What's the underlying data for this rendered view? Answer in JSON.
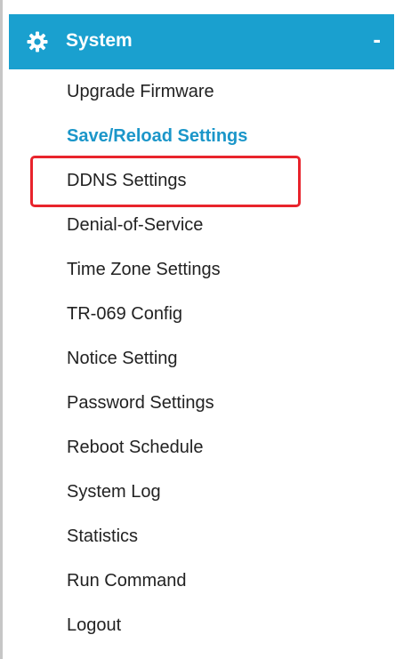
{
  "colors": {
    "header_background": "#1aa0cf",
    "header_text": "#ffffff",
    "active_item_text": "#1b96c9",
    "item_text": "#222222",
    "highlight_box": "#e8242c"
  },
  "menu": {
    "header": {
      "icon": "gear-icon",
      "title": "System",
      "collapse_label": "-"
    },
    "selected_item": "Save/Reload Settings",
    "items": [
      {
        "label": "Upgrade Firmware"
      },
      {
        "label": "Save/Reload Settings"
      },
      {
        "label": "DDNS Settings"
      },
      {
        "label": "Denial-of-Service"
      },
      {
        "label": "Time Zone Settings"
      },
      {
        "label": "TR-069 Config"
      },
      {
        "label": "Notice Setting"
      },
      {
        "label": "Password Settings"
      },
      {
        "label": "Reboot Schedule"
      },
      {
        "label": "System Log"
      },
      {
        "label": "Statistics"
      },
      {
        "label": "Run Command"
      },
      {
        "label": "Logout"
      }
    ]
  }
}
